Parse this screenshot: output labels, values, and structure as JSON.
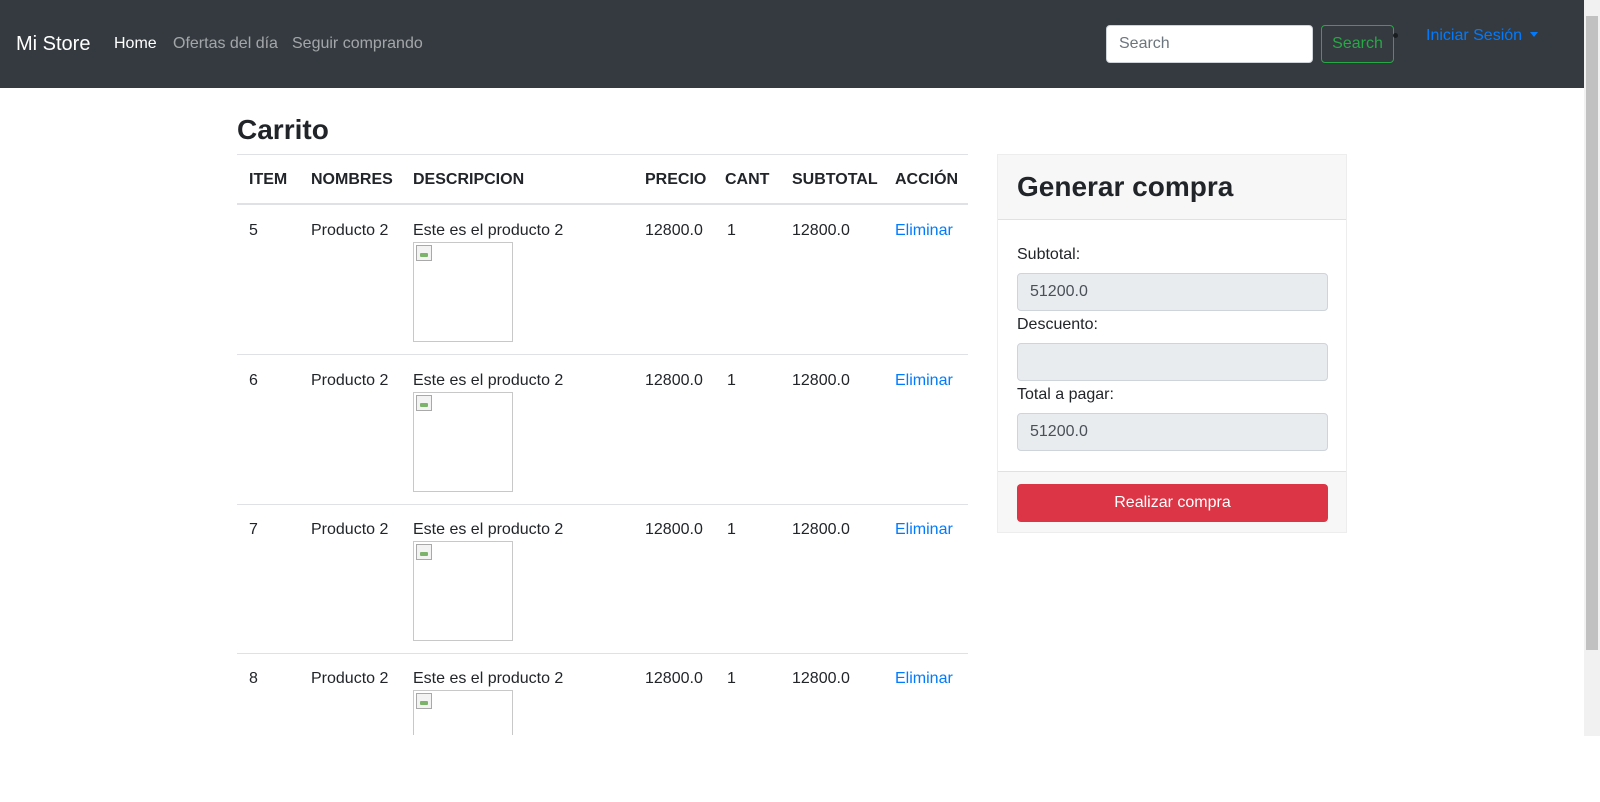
{
  "navbar": {
    "brand": "Mi Store",
    "links": [
      "Home",
      "Ofertas del día",
      "Seguir comprando"
    ],
    "search_placeholder": "Search",
    "search_button": "Search",
    "login": "Iniciar Sesión"
  },
  "cart": {
    "title": "Carrito",
    "headers": [
      "ITEM",
      "NOMBRES",
      "DESCRIPCION",
      "PRECIO",
      "CANT",
      "SUBTOTAL",
      "ACCIÓN"
    ],
    "rows": [
      {
        "item": "5",
        "nombre": "Producto 2",
        "descripcion": "Este es el producto 2",
        "precio": "12800.0",
        "cant": "1",
        "subtotal": "12800.0",
        "accion": "Eliminar"
      },
      {
        "item": "6",
        "nombre": "Producto 2",
        "descripcion": "Este es el producto 2",
        "precio": "12800.0",
        "cant": "1",
        "subtotal": "12800.0",
        "accion": "Eliminar"
      },
      {
        "item": "7",
        "nombre": "Producto 2",
        "descripcion": "Este es el producto 2",
        "precio": "12800.0",
        "cant": "1",
        "subtotal": "12800.0",
        "accion": "Eliminar"
      },
      {
        "item": "8",
        "nombre": "Producto 2",
        "descripcion": "Este es el producto 2",
        "precio": "12800.0",
        "cant": "1",
        "subtotal": "12800.0",
        "accion": "Eliminar"
      }
    ]
  },
  "summary": {
    "title": "Generar compra",
    "subtotal_label": "Subtotal:",
    "subtotal_value": "51200.0",
    "descuento_label": "Descuento:",
    "descuento_value": "",
    "total_label": "Total a pagar:",
    "total_value": "51200.0",
    "buy_button": "Realizar compra"
  },
  "colors": {
    "navbar_bg": "#343a40",
    "link": "#007bff",
    "success": "#28a745",
    "danger": "#dc3545"
  }
}
